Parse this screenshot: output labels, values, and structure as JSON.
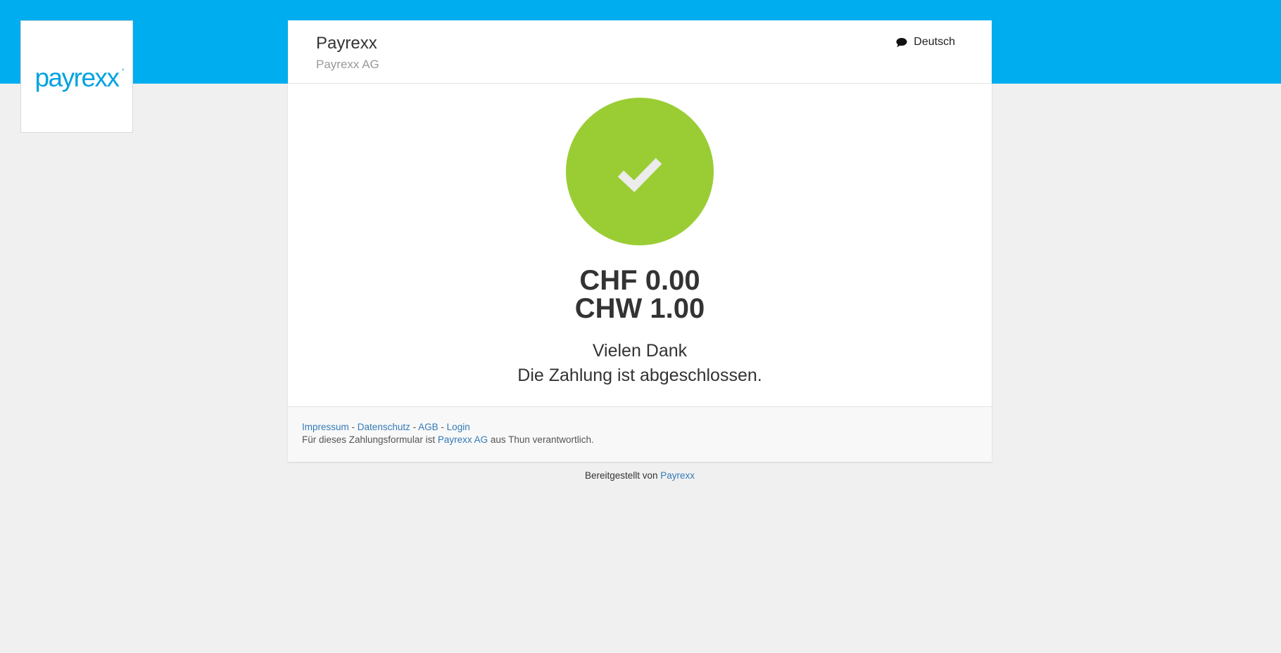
{
  "brand": {
    "logo_text": "payrexx",
    "logo_mark": "'",
    "accent_color": "#00aeef",
    "success_color": "#9acd34",
    "link_color": "#337ab7"
  },
  "header": {
    "merchant_name": "Payrexx",
    "merchant_company": "Payrexx AG",
    "language": "Deutsch",
    "language_icon": "chat-bubble-icon"
  },
  "status": {
    "icon": "check-icon",
    "amounts": [
      "CHF 0.00",
      "CHW 1.00"
    ],
    "message_line1": "Vielen Dank",
    "message_line2": "Die Zahlung ist abgeschlossen."
  },
  "footer": {
    "links": [
      "Impressum",
      "Datenschutz",
      "AGB",
      "Login"
    ],
    "separator": "-",
    "responsibility_prefix": "Für dieses Zahlungsformular ist",
    "responsibility_link": "Payrexx AG",
    "responsibility_suffix": "aus Thun verantwortlich."
  },
  "powered_by": {
    "prefix": "Bereitgestellt von",
    "link": "Payrexx"
  }
}
